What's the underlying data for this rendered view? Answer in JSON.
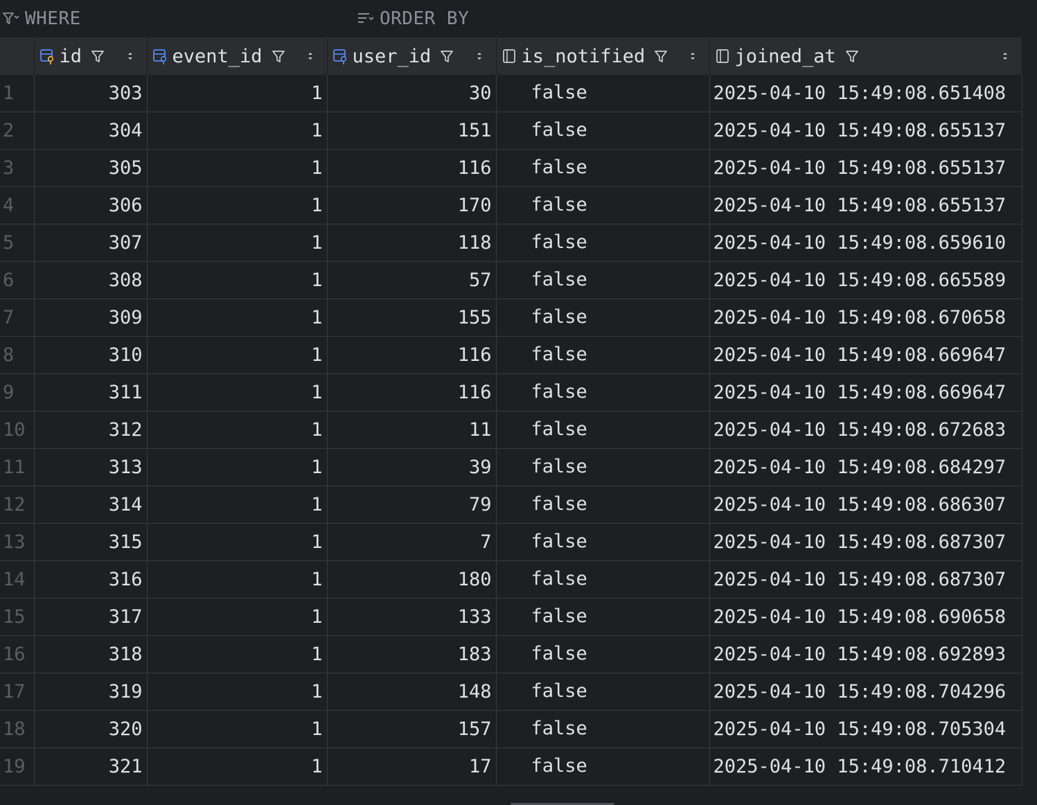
{
  "filter_bar": {
    "where_label": "WHERE",
    "order_by_label": "ORDER BY"
  },
  "columns": [
    {
      "name": "id",
      "icon": "primary-key-column-icon"
    },
    {
      "name": "event_id",
      "icon": "foreign-key-column-icon"
    },
    {
      "name": "user_id",
      "icon": "foreign-key-column-icon"
    },
    {
      "name": "is_notified",
      "icon": "column-icon"
    },
    {
      "name": "joined_at",
      "icon": "column-icon"
    }
  ],
  "rows": [
    {
      "n": "1",
      "id": "303",
      "event_id": "1",
      "user_id": "30",
      "is_notified": "false",
      "joined_at": "2025-04-10 15:49:08.651408"
    },
    {
      "n": "2",
      "id": "304",
      "event_id": "1",
      "user_id": "151",
      "is_notified": "false",
      "joined_at": "2025-04-10 15:49:08.655137"
    },
    {
      "n": "3",
      "id": "305",
      "event_id": "1",
      "user_id": "116",
      "is_notified": "false",
      "joined_at": "2025-04-10 15:49:08.655137"
    },
    {
      "n": "4",
      "id": "306",
      "event_id": "1",
      "user_id": "170",
      "is_notified": "false",
      "joined_at": "2025-04-10 15:49:08.655137"
    },
    {
      "n": "5",
      "id": "307",
      "event_id": "1",
      "user_id": "118",
      "is_notified": "false",
      "joined_at": "2025-04-10 15:49:08.659610"
    },
    {
      "n": "6",
      "id": "308",
      "event_id": "1",
      "user_id": "57",
      "is_notified": "false",
      "joined_at": "2025-04-10 15:49:08.665589"
    },
    {
      "n": "7",
      "id": "309",
      "event_id": "1",
      "user_id": "155",
      "is_notified": "false",
      "joined_at": "2025-04-10 15:49:08.670658"
    },
    {
      "n": "8",
      "id": "310",
      "event_id": "1",
      "user_id": "116",
      "is_notified": "false",
      "joined_at": "2025-04-10 15:49:08.669647"
    },
    {
      "n": "9",
      "id": "311",
      "event_id": "1",
      "user_id": "116",
      "is_notified": "false",
      "joined_at": "2025-04-10 15:49:08.669647"
    },
    {
      "n": "10",
      "id": "312",
      "event_id": "1",
      "user_id": "11",
      "is_notified": "false",
      "joined_at": "2025-04-10 15:49:08.672683"
    },
    {
      "n": "11",
      "id": "313",
      "event_id": "1",
      "user_id": "39",
      "is_notified": "false",
      "joined_at": "2025-04-10 15:49:08.684297"
    },
    {
      "n": "12",
      "id": "314",
      "event_id": "1",
      "user_id": "79",
      "is_notified": "false",
      "joined_at": "2025-04-10 15:49:08.686307"
    },
    {
      "n": "13",
      "id": "315",
      "event_id": "1",
      "user_id": "7",
      "is_notified": "false",
      "joined_at": "2025-04-10 15:49:08.687307"
    },
    {
      "n": "14",
      "id": "316",
      "event_id": "1",
      "user_id": "180",
      "is_notified": "false",
      "joined_at": "2025-04-10 15:49:08.687307"
    },
    {
      "n": "15",
      "id": "317",
      "event_id": "1",
      "user_id": "133",
      "is_notified": "false",
      "joined_at": "2025-04-10 15:49:08.690658"
    },
    {
      "n": "16",
      "id": "318",
      "event_id": "1",
      "user_id": "183",
      "is_notified": "false",
      "joined_at": "2025-04-10 15:49:08.692893"
    },
    {
      "n": "17",
      "id": "319",
      "event_id": "1",
      "user_id": "148",
      "is_notified": "false",
      "joined_at": "2025-04-10 15:49:08.704296"
    },
    {
      "n": "18",
      "id": "320",
      "event_id": "1",
      "user_id": "157",
      "is_notified": "false",
      "joined_at": "2025-04-10 15:49:08.705304"
    },
    {
      "n": "19",
      "id": "321",
      "event_id": "1",
      "user_id": "17",
      "is_notified": "false",
      "joined_at": "2025-04-10 15:49:08.710412"
    }
  ],
  "colors": {
    "background": "#1e1f22",
    "header_background": "#2b2d30",
    "grid_line": "#393b40",
    "text": "#dfe1e5",
    "muted_text": "#8c9099",
    "row_number": "#5a5d63",
    "key_icon_blue": "#548af7",
    "key_icon_gold": "#e0b44a"
  }
}
